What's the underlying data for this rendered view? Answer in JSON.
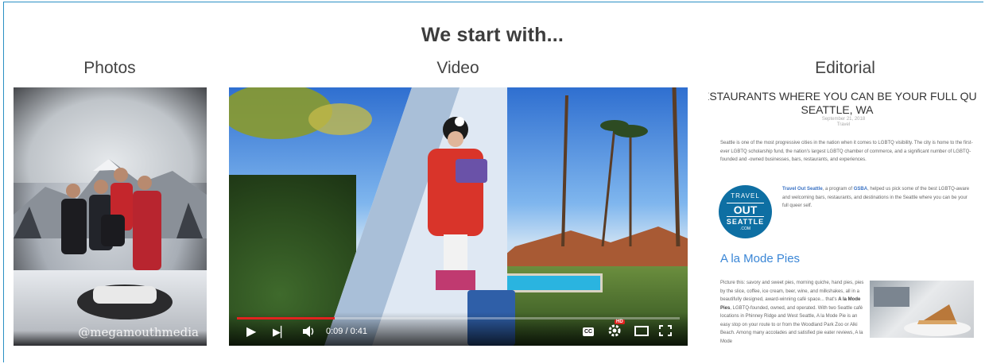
{
  "heading": "We start with...",
  "columns": {
    "photos": "Photos",
    "video": "Video",
    "editorial": "Editorial"
  },
  "photo": {
    "watermark": "@megamouthmedia"
  },
  "video": {
    "time": "0:09 / 0:41",
    "progress": 0.22,
    "icons": [
      "play-icon",
      "next-icon",
      "volume-icon",
      "captions-icon",
      "settings-icon",
      "theater-icon",
      "fullscreen-icon"
    ],
    "cc_label": "CC",
    "hd_label": "HD"
  },
  "editorial": {
    "title_line1": "ESTAURANTS WHERE YOU CAN BE YOUR FULL QU",
    "title_line2": "SEATTLE, WA",
    "date": "September 21, 2018",
    "category": "Travel",
    "para1": "Seattle is one of the most progressive cities in the nation when it comes to LGBTQ visibility. The city is home to the first-ever LGBTQ scholarship fund, the nation's largest LGBTQ chamber of commerce, and a significant number of LGBTQ-founded and -owned businesses, bars, restaurants, and experiences.",
    "para2_link": "Travel Out Seattle",
    "para2_mid": ", a program of ",
    "para2_link2": "GSBA",
    "para2_rest": ", helped us pick some of the best LGBTQ-aware and welcoming bars, restaurants, and destinations in the Seattle where you can be your full queer self.",
    "logo": {
      "line1": "TRAVEL",
      "line2": "OUT",
      "line3": "SEATTLE",
      "line4": ".COM"
    },
    "section_title": "A la Mode Pies",
    "para3_a": "Picture this: savory and sweet pies, morning quiche, hand pies, pies by the slice, coffee, ice cream, beer, wine, and milkshakes, all in a beautifully designed, award-winning café space... that's ",
    "para3_b": "A la Mode Pies",
    "para3_c": ", LGBTQ-founded, owned, and operated. With two Seattle café locations in Phinney Ridge and West Seattle, A la Mode Pie is an easy stop on your route to or from the Woodland Park Zoo or Alki Beach. Among many accolades and satisfied pie eater reviews, A la Mode"
  },
  "colors": {
    "frame_border": "#2a8fc4",
    "link": "#3a72c4",
    "section_title": "#3a86d6",
    "logo_bg": "#0e6fa3",
    "progress": "#e1231f"
  }
}
